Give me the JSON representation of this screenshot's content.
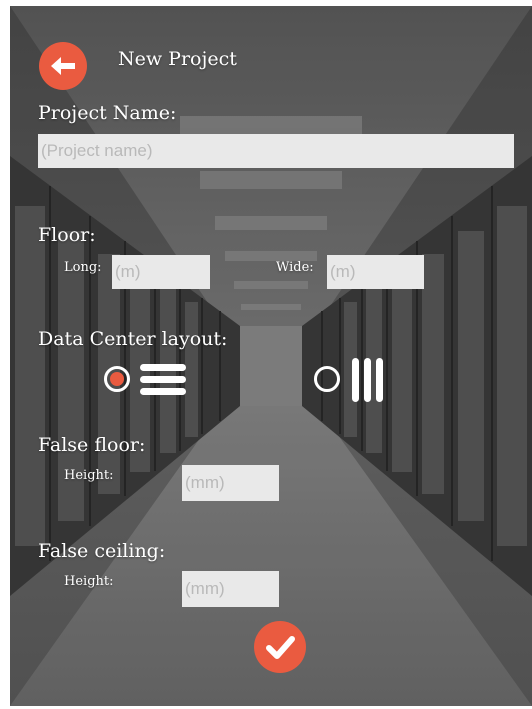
{
  "header": {
    "title": "New Project",
    "back_icon": "arrow-left-icon"
  },
  "project_name": {
    "label": "Project Name:",
    "placeholder": "(Project name)",
    "value": ""
  },
  "floor": {
    "label": "Floor:",
    "long_label": "Long:",
    "long_placeholder": "(m)",
    "wide_label": "Wide:",
    "wide_placeholder": "(m)"
  },
  "layout": {
    "label": "Data Center layout:",
    "options": [
      {
        "name": "horizontal-rows",
        "icon": "horizontal-bars-icon",
        "selected": true
      },
      {
        "name": "vertical-rows",
        "icon": "vertical-bars-icon",
        "selected": false
      }
    ]
  },
  "false_floor": {
    "label": "False floor:",
    "height_label": "Height:",
    "height_placeholder": "(mm)"
  },
  "false_ceiling": {
    "label": "False ceiling:",
    "height_label": "Height:",
    "height_placeholder": "(mm)"
  },
  "confirm": {
    "icon": "checkmark-icon"
  },
  "colors": {
    "accent": "#ea5b40",
    "field_bg": "#e9e9e9",
    "text": "#ffffff"
  }
}
